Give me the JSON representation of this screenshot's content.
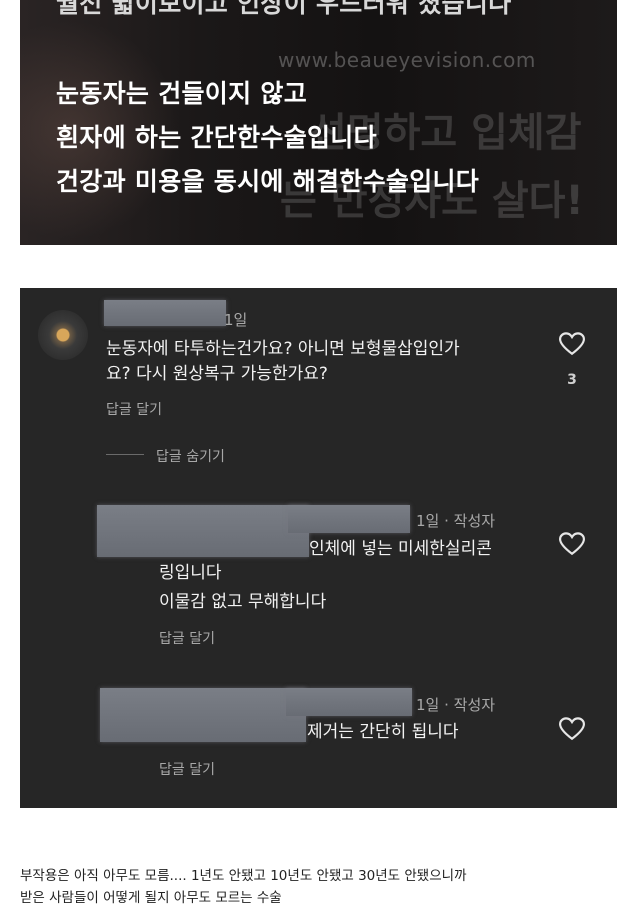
{
  "video": {
    "top_line": "월전 쉷이보이고 인상이 우드러워 졌습니다",
    "watermark": "www.beaueyevision.com",
    "bg_caption_1": "선명하고 입체감",
    "bg_caption_2": "는 만정자도 살다!",
    "lines": [
      "눈동자는 건들이지 않고",
      "흰자에 하는 간단한수술입니다",
      "건강과 미용을 동시에 해결한수술입니다"
    ]
  },
  "comments": {
    "main": {
      "time": "1일",
      "text_line1": "눈동자에 타투하는건가요? 아니면 보형물삽입인가",
      "text_line2": "요? 다시 원상복구 가능한가요?",
      "reply_label": "답글 달기",
      "likes": "3",
      "heart_icon": "heart-outline-icon"
    },
    "hide_replies": "답글 숨기기",
    "replies": [
      {
        "meta": "1일 · 작성자",
        "text_line1": "인체에 넣는 미세한실리콘",
        "text_line2": "링입니다",
        "text_line3": "이물감 없고 무해합니다",
        "reply_label": "답글 달기"
      },
      {
        "meta": "1일 · 작성자",
        "text_line1": "제거는 간단히 됩니다",
        "reply_label": "답글 달기"
      }
    ],
    "colors": {
      "panel_bg": "#262626",
      "text": "#f2f2f2",
      "muted": "#a8a8a8"
    }
  },
  "caption": {
    "line1": "부작용은 아직 아무도 모름.... 1년도 안됐고 10년도 안됐고 30년도 안됐으니까",
    "line2": "받은 사람들이 어떻게 될지 아무도 모르는 수술"
  }
}
